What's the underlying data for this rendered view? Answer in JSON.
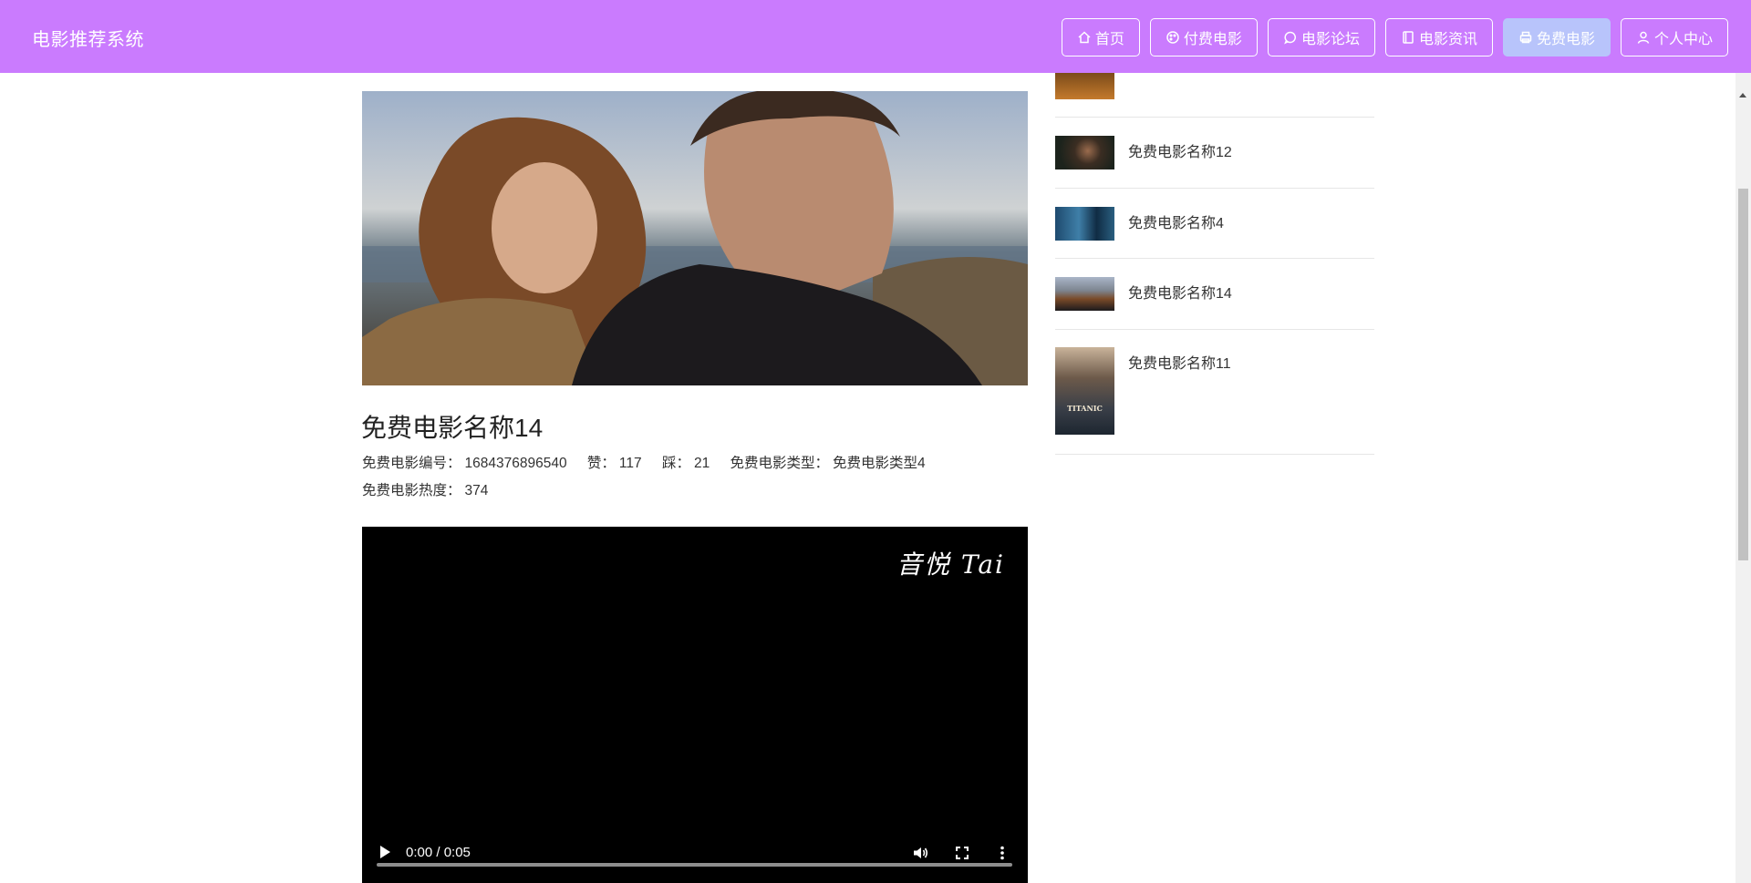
{
  "header": {
    "brand": "电影推荐系统",
    "nav": [
      {
        "label": "首页",
        "icon": "home-icon",
        "active": false
      },
      {
        "label": "付费电影",
        "icon": "palette-icon",
        "active": false
      },
      {
        "label": "电影论坛",
        "icon": "chat-bubble-icon",
        "active": false
      },
      {
        "label": "电影资讯",
        "icon": "notebook-icon",
        "active": false
      },
      {
        "label": "免费电影",
        "icon": "printer-icon",
        "active": true
      },
      {
        "label": "个人中心",
        "icon": "user-icon",
        "active": false
      }
    ]
  },
  "movie": {
    "title": "免费电影名称14",
    "number_label": "免费电影编号：",
    "number_value": "1684376896540",
    "like_label": "赞：",
    "like_value": "117",
    "dislike_label": "踩：",
    "dislike_value": "21",
    "type_label": "免费电影类型：",
    "type_value": "免费电影类型4",
    "heat_label": "免费电影热度：",
    "heat_value": "374"
  },
  "video": {
    "watermark": "音悦 Tai",
    "time": "0:00 / 0:05"
  },
  "sidebar": {
    "items": [
      {
        "label": "",
        "thumb": "orange-poster"
      },
      {
        "label": "免费电影名称12",
        "thumb": "joker-poster"
      },
      {
        "label": "免费电影名称4",
        "thumb": "avatar-poster"
      },
      {
        "label": "免费电影名称14",
        "thumb": "couple-poster"
      },
      {
        "label": "免费电影名称11",
        "thumb": "titanic-poster",
        "thumb_text": "TITANIC"
      }
    ]
  },
  "colors": {
    "header_bg": "#ca7bfe",
    "active_nav_bg": "#b8c4fb"
  }
}
